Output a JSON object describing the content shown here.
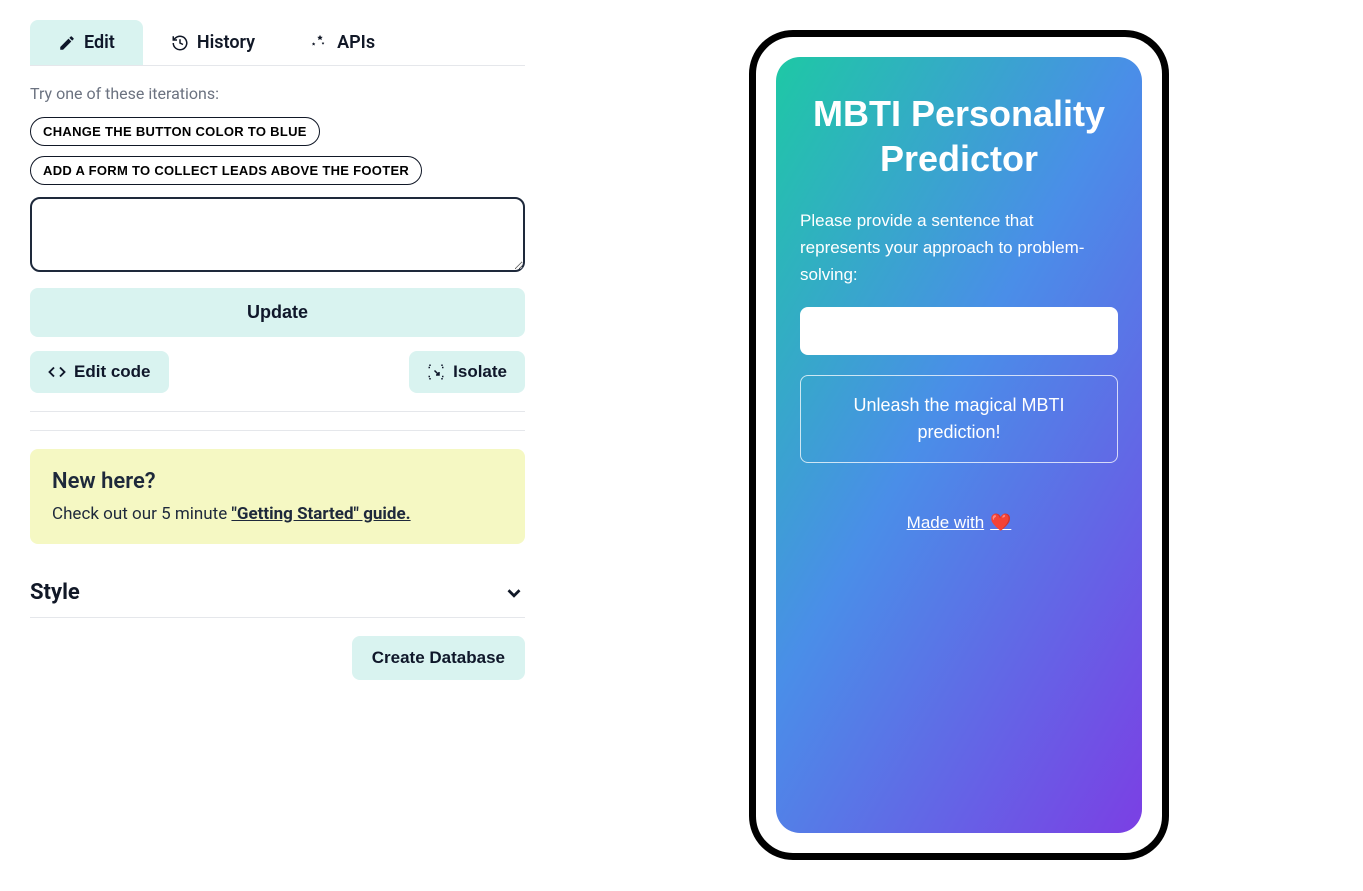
{
  "tabs": {
    "edit": "Edit",
    "history": "History",
    "apis": "APIs"
  },
  "editor": {
    "tryLabel": "Try one of these iterations:",
    "suggestions": [
      "CHANGE THE BUTTON COLOR TO BLUE",
      "ADD A FORM TO COLLECT LEADS ABOVE THE FOOTER"
    ],
    "textareaValue": "",
    "updateBtn": "Update",
    "editCodeBtn": "Edit code",
    "isolateBtn": "Isolate"
  },
  "notice": {
    "title": "New here?",
    "textPrefix": "Check out our 5 minute ",
    "linkText": "\"Getting Started\" guide."
  },
  "styleSection": {
    "label": "Style"
  },
  "database": {
    "btn": "Create Database"
  },
  "preview": {
    "title": "MBTI Personality Predictor",
    "instruction": "Please provide a sentence that represents your approach to problem-solving:",
    "inputValue": "",
    "button": "Unleash the magical MBTI prediction!",
    "footerText": "Made with",
    "footerHeart": "❤️"
  }
}
